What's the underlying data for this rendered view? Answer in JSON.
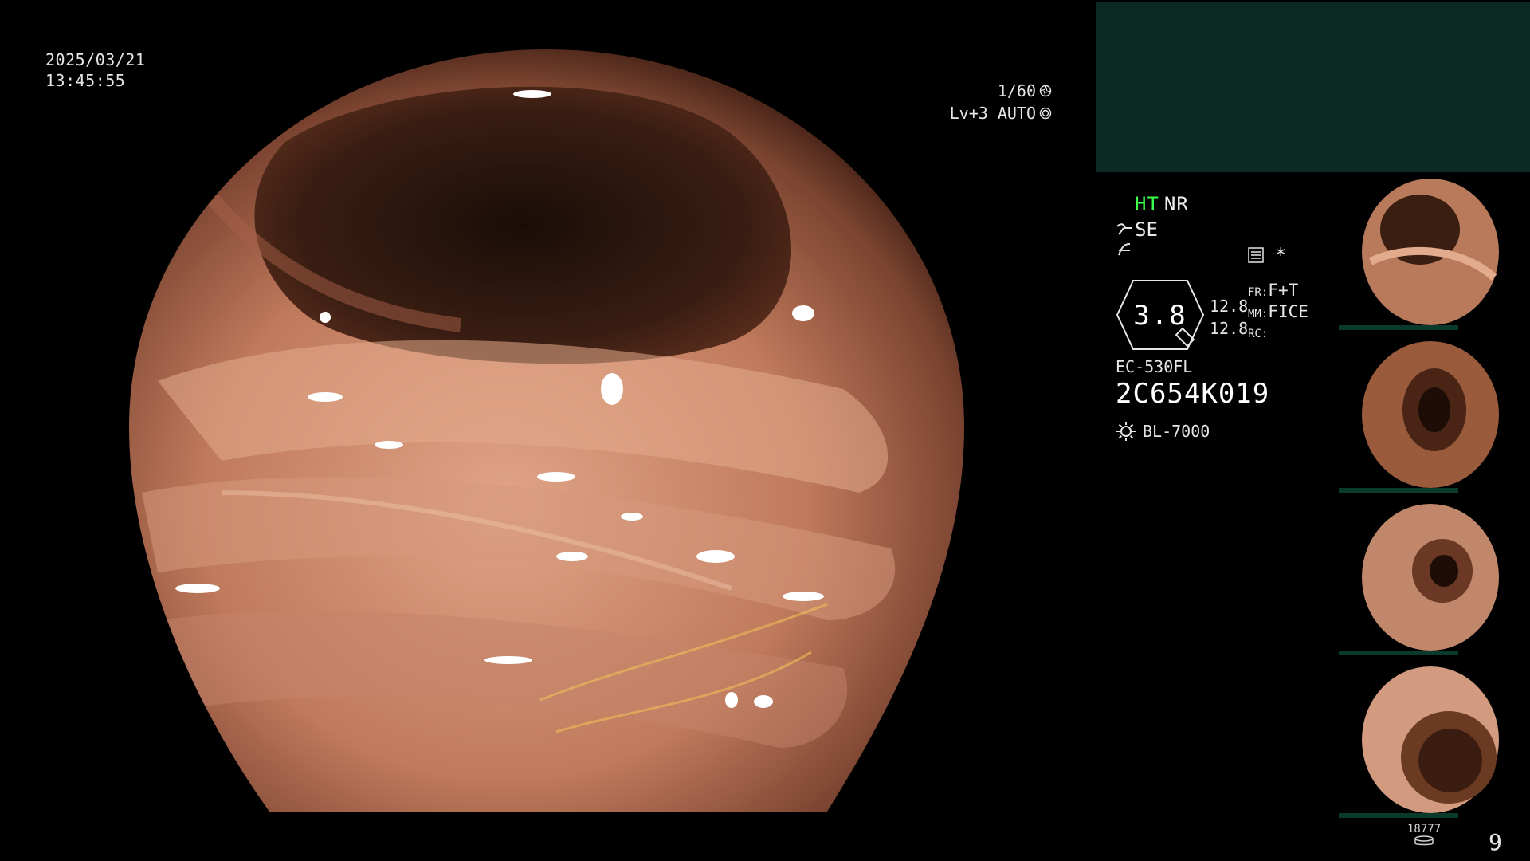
{
  "overlay": {
    "date": "2025/03/21",
    "time": "13:45:55",
    "shutter": "1/60",
    "level": "Lv+3 AUTO"
  },
  "status": {
    "ht": "HT",
    "nr": "NR",
    "se": "SE",
    "star": "*",
    "zoom": "3.8",
    "val1": "12.8",
    "val2": "12.8",
    "fr_label": "FR:",
    "fr_value": "F+T",
    "mm_label": "MM:",
    "mm_value": "FICE",
    "rc_label": "RC:",
    "scope_model": "EC-530FL",
    "serial": "2C654K019",
    "light_source": "BL-7000"
  },
  "footer": {
    "image_count": "18777",
    "page": "9"
  },
  "colors": {
    "ht_green": "#3dff4a",
    "top_panel": "#0a2a23",
    "tissue": "#c98a6e"
  },
  "icons": [
    "shutter-icon",
    "auto-iris-icon",
    "se-curve-icon",
    "gamma-icon",
    "settings-icon",
    "hexagon-zoom-icon",
    "lamp-icon",
    "disk-icon"
  ],
  "thumbnails": [
    {
      "label": "capture-1"
    },
    {
      "label": "capture-2"
    },
    {
      "label": "capture-3"
    },
    {
      "label": "capture-4"
    }
  ]
}
